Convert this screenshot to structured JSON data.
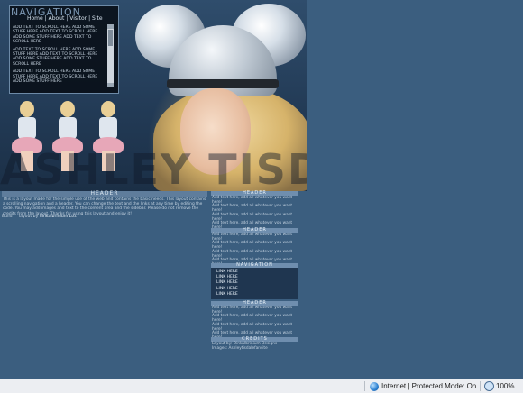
{
  "header": {
    "big_name": "ASHLEY TISDALE"
  },
  "nav_box": {
    "title": "NAVIGATION",
    "links": [
      "Home",
      "About",
      "Visitor",
      "Site"
    ],
    "separator": "|",
    "paragraphs": [
      "ADD TEXT TO SCROLL HERE ADD SOME STUFF HERE ADD TEXT TO SCROLL HERE ADD SOME STUFF HERE ADD TEXT TO SCROLL HERE",
      "ADD TEXT TO SCROLL HERE ADD SOME STUFF HERE ADD TEXT TO SCROLL HERE ADD SOME STUFF HERE ADD TEXT TO SCROLL HERE",
      "ADD TEXT TO SCROLL HERE ADD SOME STUFF HERE ADD TEXT TO SCROLL HERE ADD SOME STUFF HERE"
    ]
  },
  "main": {
    "header": "HEADER",
    "text": "This is a layout made for the simple use of the web and contains the basic needs. This layout contains a scrolling navigation and a header. You can change the text and the links at any time by editing the code. You may add images and text to the content area and the sidebar. Please do not remove the credits from the layout. Thanks for using this layout and enjoy it!",
    "credit_prefix": "Build",
    "credit_mid": "layout by",
    "credit_suffix": "dinkalbrinium Ltd."
  },
  "sidebar": {
    "blocks": [
      {
        "header": "HEADER",
        "lines": [
          "Add text here, add all whatever you want here!",
          "Add text here, add all whatever you want here!",
          "Add text here, add all whatever you want here!",
          "Add text here, add all whatever you want here!"
        ]
      },
      {
        "header": "HEADER",
        "lines": [
          "Add text here, add all whatever you want here!",
          "Add text here, add all whatever you want here!",
          "Add text here, add all whatever you want here!",
          "Add text here, add all whatever you want here!"
        ]
      }
    ],
    "navigation": {
      "header": "NAVIGATION",
      "links": [
        "LINK HERE",
        "LINK HERE",
        "LINK HERE",
        "LINK HERE",
        "LINK HERE"
      ]
    },
    "header_block3": {
      "header": "HEADER",
      "lines": [
        "Add text here, add all whatever you want here!",
        "Add text here, add all whatever you want here!",
        "Add text here, add all whatever you want here!",
        "Add text here, add all whatever you want here!"
      ]
    },
    "credits": {
      "header": "CREDITS",
      "lines": [
        "Layout by: Dinkalbrinium Designs",
        "Images: Ashleytisdalefansite"
      ]
    }
  },
  "statusbar": {
    "zone_text": "Internet | Protected Mode: On",
    "zoom_text": "100%"
  }
}
